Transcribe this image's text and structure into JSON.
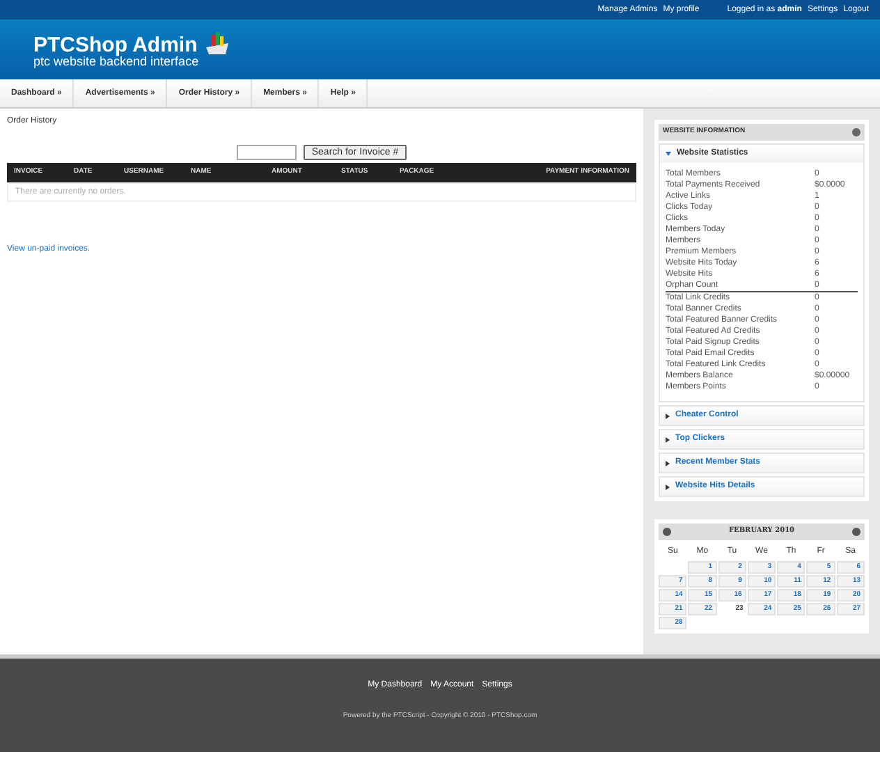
{
  "top_bar": {
    "left_links": [
      "Manage Admins",
      "My profile"
    ],
    "login_prefix": "Logged in as",
    "user": "admin",
    "right_links": [
      "Settings",
      "Logout"
    ]
  },
  "header": {
    "title": "PTCShop Admin",
    "subtitle": "ptc website backend interface"
  },
  "nav": [
    "Dashboard »",
    "Advertisements »",
    "Order History »",
    "Members »",
    "Help »"
  ],
  "page_title": "Order History",
  "search": {
    "button": "Search for Invoice #"
  },
  "table": {
    "columns": [
      "INVOICE",
      "DATE",
      "USERNAME",
      "NAME",
      "AMOUNT",
      "STATUS",
      "PACKAGE",
      "PAYMENT INFORMATION"
    ],
    "empty": "There are currently no orders."
  },
  "unpaid_link": "View un-paid invoices.",
  "sidebar": {
    "title": "WEBSITE INFORMATION",
    "sections": [
      {
        "title": "Website Statistics",
        "expanded": true,
        "groups": [
          [
            {
              "label": "Total Members",
              "value": "0"
            },
            {
              "label": "Total Payments Received",
              "value": "$0.0000"
            },
            {
              "label": "Active Links",
              "value": "1"
            },
            {
              "label": "Clicks Today",
              "value": "0"
            },
            {
              "label": "Clicks",
              "value": "0"
            },
            {
              "label": "Members Today",
              "value": "0"
            },
            {
              "label": "Members",
              "value": "0"
            },
            {
              "label": "Premium Members",
              "value": "0"
            },
            {
              "label": "Website Hits Today",
              "value": "6"
            },
            {
              "label": "Website Hits",
              "value": "6"
            },
            {
              "label": "Orphan Count",
              "value": "0"
            }
          ],
          [
            {
              "label": "Total Link Credits",
              "value": "0"
            },
            {
              "label": "Total Banner Credits",
              "value": "0"
            },
            {
              "label": "Total Featured Banner Credits",
              "value": "0"
            },
            {
              "label": "Total Featured Ad Credits",
              "value": "0"
            },
            {
              "label": "Total Paid Signup Credits",
              "value": "0"
            },
            {
              "label": "Total Paid Email Credits",
              "value": "0"
            },
            {
              "label": "Total Featured Link Credits",
              "value": "0"
            },
            {
              "label": "Members Balance",
              "value": "$0.00000"
            },
            {
              "label": "Members Points",
              "value": "0"
            }
          ]
        ]
      },
      {
        "title": "Cheater Control",
        "expanded": false
      },
      {
        "title": "Top Clickers",
        "expanded": false
      },
      {
        "title": "Recent Member Stats",
        "expanded": false
      },
      {
        "title": "Website Hits Details",
        "expanded": false
      }
    ]
  },
  "calendar": {
    "month": "FEBRUARY 2010",
    "weekdays": [
      "Su",
      "Mo",
      "Tu",
      "We",
      "Th",
      "Fr",
      "Sa"
    ],
    "weeks": [
      [
        {
          "day": "1",
          "selected": false
        },
        {
          "day": "2",
          "selected": false
        },
        {
          "day": "3",
          "selected": false
        },
        {
          "day": "4",
          "selected": false
        },
        {
          "day": "5",
          "selected": false
        },
        {
          "day": "6",
          "selected": false
        }
      ],
      [
        {
          "day": "7",
          "selected": false
        },
        {
          "day": "8",
          "selected": false
        },
        {
          "day": "9",
          "selected": false
        },
        {
          "day": "10",
          "selected": false
        },
        {
          "day": "11",
          "selected": false
        },
        {
          "day": "12",
          "selected": false
        },
        {
          "day": "13",
          "selected": false
        }
      ],
      [
        {
          "day": "14",
          "selected": false
        },
        {
          "day": "15",
          "selected": false
        },
        {
          "day": "16",
          "selected": false
        },
        {
          "day": "17",
          "selected": false
        },
        {
          "day": "18",
          "selected": false
        },
        {
          "day": "19",
          "selected": false
        },
        {
          "day": "20",
          "selected": false
        }
      ],
      [
        {
          "day": "21",
          "selected": false
        },
        {
          "day": "22",
          "selected": false
        },
        {
          "day": "23",
          "selected": true
        },
        {
          "day": "24",
          "selected": false
        },
        {
          "day": "25",
          "selected": false
        },
        {
          "day": "26",
          "selected": false
        },
        {
          "day": "27",
          "selected": false
        }
      ],
      [
        {
          "day": "28",
          "selected": false
        }
      ]
    ]
  },
  "footer": {
    "links": [
      "My Dashboard",
      "My Account",
      "Settings"
    ],
    "copyright": "Powered by the PTCScript - Copyright © 2010 - PTCShop.com"
  }
}
